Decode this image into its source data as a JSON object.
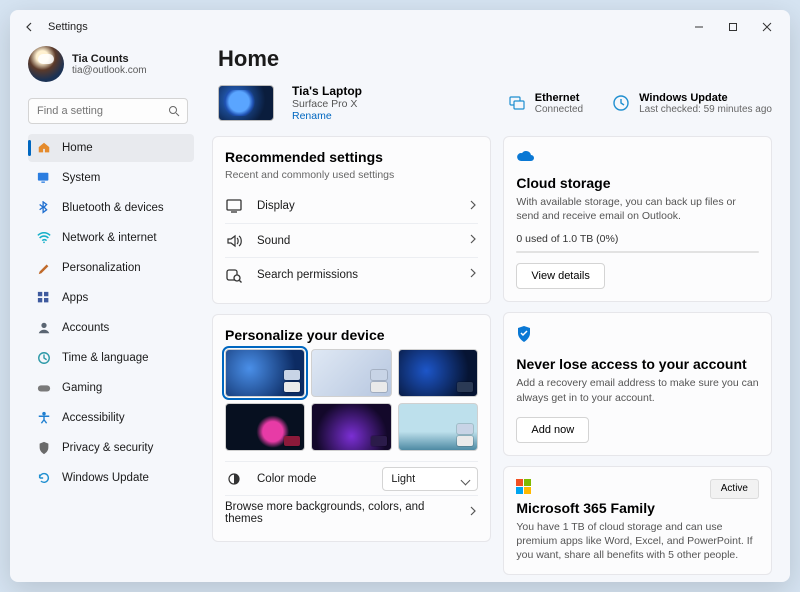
{
  "titlebar": {
    "title": "Settings"
  },
  "profile": {
    "name": "Tia Counts",
    "email": "tia@outlook.com"
  },
  "search": {
    "placeholder": "Find a setting"
  },
  "nav": [
    {
      "icon": "home",
      "label": "Home",
      "active": true,
      "color": "#e58b2c"
    },
    {
      "icon": "system",
      "label": "System",
      "color": "#2b7de0"
    },
    {
      "icon": "bluetooth",
      "label": "Bluetooth & devices",
      "color": "#1f6fd0"
    },
    {
      "icon": "wifi",
      "label": "Network & internet",
      "color": "#17b1c9"
    },
    {
      "icon": "brush",
      "label": "Personalization",
      "color": "#c06a2b"
    },
    {
      "icon": "apps",
      "label": "Apps",
      "color": "#3e5a9e"
    },
    {
      "icon": "account",
      "label": "Accounts",
      "color": "#5a6572"
    },
    {
      "icon": "time",
      "label": "Time & language",
      "color": "#2e9aa8"
    },
    {
      "icon": "gaming",
      "label": "Gaming",
      "color": "#7a7a7a"
    },
    {
      "icon": "accessibility",
      "label": "Accessibility",
      "color": "#1f7fd0"
    },
    {
      "icon": "privacy",
      "label": "Privacy & security",
      "color": "#6a6a6a"
    },
    {
      "icon": "update",
      "label": "Windows Update",
      "color": "#1f8fd0"
    }
  ],
  "page_title": "Home",
  "device": {
    "name": "Tia's Laptop",
    "model": "Surface Pro X",
    "rename": "Rename"
  },
  "status": {
    "net": {
      "title": "Ethernet",
      "sub": "Connected"
    },
    "update": {
      "title": "Windows Update",
      "sub": "Last checked: 59 minutes ago"
    }
  },
  "recommended": {
    "title": "Recommended settings",
    "sub": "Recent and commonly used settings",
    "items": [
      {
        "icon": "display",
        "label": "Display"
      },
      {
        "icon": "sound",
        "label": "Sound"
      },
      {
        "icon": "search",
        "label": "Search permissions"
      }
    ]
  },
  "personalize": {
    "title": "Personalize your device",
    "color_mode_label": "Color mode",
    "color_mode_value": "Light",
    "browse": "Browse more backgrounds, colors, and themes"
  },
  "cloud": {
    "title": "Cloud storage",
    "body": "With available storage, you can back up files or send and receive email on Outlook.",
    "usage": "0 used of 1.0 TB (0%)",
    "button": "View details"
  },
  "recovery": {
    "title": "Never lose access to your account",
    "body": "Add a recovery email address to make sure you can always get in to your account.",
    "button": "Add now"
  },
  "m365": {
    "title": "Microsoft 365 Family",
    "badge": "Active",
    "body": "You have 1 TB of cloud storage and can use premium apps like Word, Excel, and PowerPoint. If you want, share all benefits with 5 other people."
  }
}
